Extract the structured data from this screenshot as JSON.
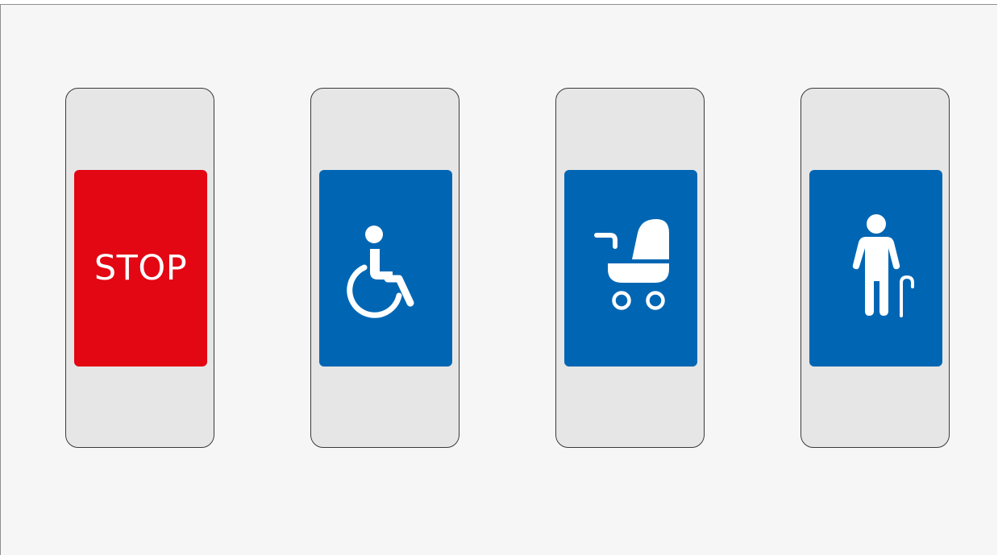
{
  "colors": {
    "stop_red": "#e30613",
    "info_blue": "#0066b3",
    "panel_grey": "#e6e6e6",
    "background": "#f6f6f6"
  },
  "buttons": [
    {
      "label": "STOP",
      "icon": "stop-text"
    },
    {
      "label": "",
      "icon": "wheelchair-icon"
    },
    {
      "label": "",
      "icon": "stroller-icon"
    },
    {
      "label": "",
      "icon": "elderly-person-icon"
    }
  ]
}
